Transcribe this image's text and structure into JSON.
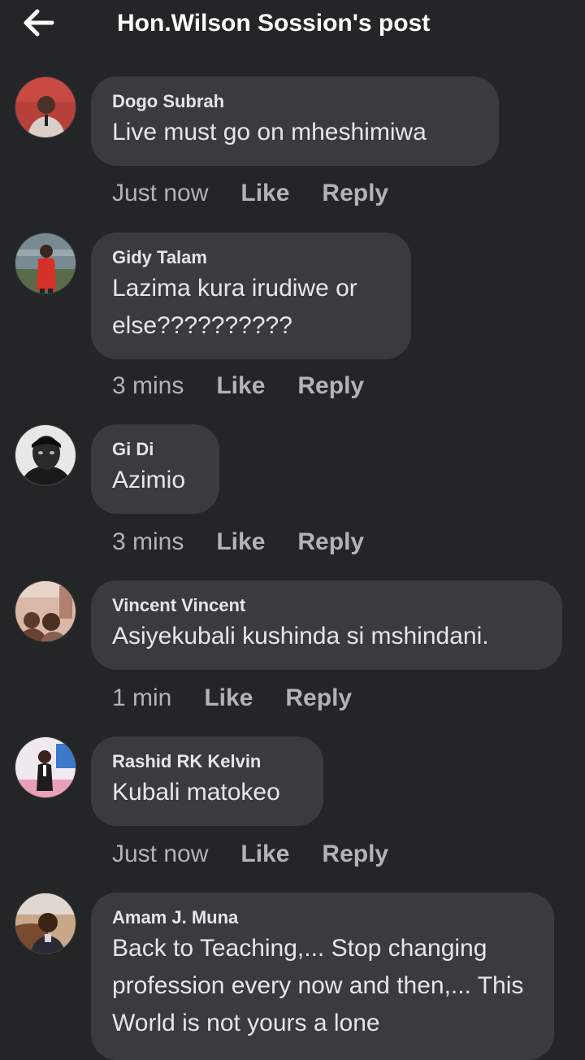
{
  "header": {
    "back_icon": "arrow-left-icon",
    "title": "Hon.Wilson Sossion's post"
  },
  "actions": {
    "like_label": "Like",
    "reply_label": "Reply"
  },
  "comments": [
    {
      "author": "Dogo Subrah",
      "text": "Live  must go on mheshimiwa",
      "time": "Just now"
    },
    {
      "author": "Gidy Talam",
      "text": "Lazima kura irudiwe or else??????????",
      "time": "3 mins"
    },
    {
      "author": "Gi Di",
      "text": "Azimio",
      "time": "3 mins"
    },
    {
      "author": "Vincent Vincent",
      "text": "Asiyekubali kushinda si mshindani.",
      "time": "1 min"
    },
    {
      "author": "Rashid RK Kelvin",
      "text": "Kubali matokeo",
      "time": "Just now"
    },
    {
      "author": "Amam J. Muna",
      "text": "Back to Teaching,... Stop changing profession every now and then,... This World is not yours a lone",
      "time": ""
    }
  ],
  "colors": {
    "background": "#242526",
    "bubble": "#3a3b3c",
    "primary_text": "#e4e6eb",
    "secondary_text": "#b0b3b8"
  }
}
